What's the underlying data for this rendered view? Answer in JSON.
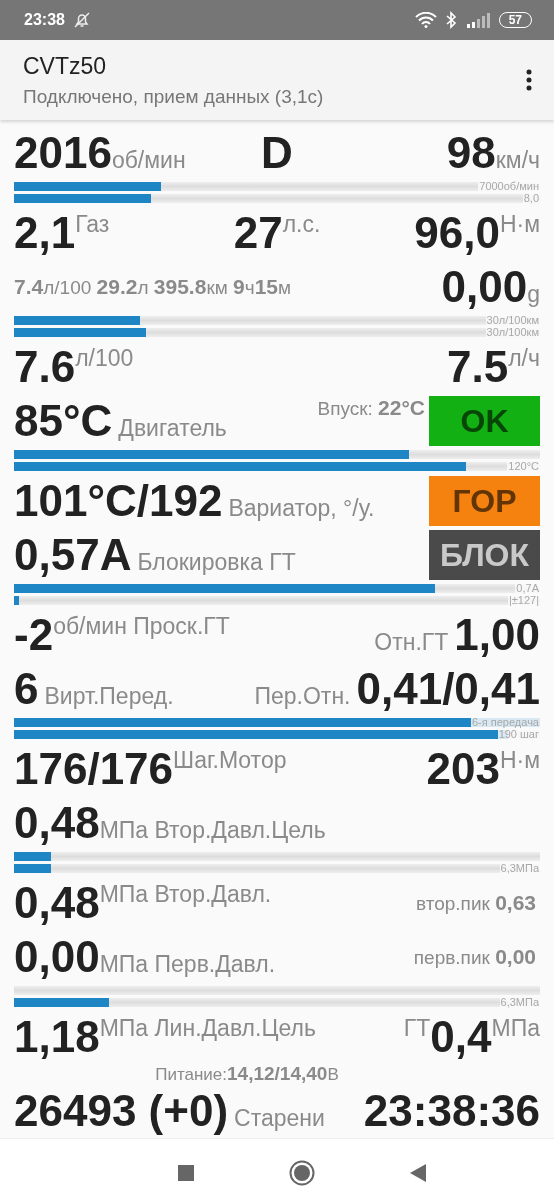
{
  "status_bar": {
    "time": "23:38",
    "battery": "57"
  },
  "app_bar": {
    "title": "CVTz50",
    "subtitle": "Подключено, прием данных (3,1с)"
  },
  "rows": [
    {
      "kind": "line",
      "left": [
        {
          "kind": "value",
          "text": "2016"
        },
        {
          "kind": "unit",
          "text": "об/мин"
        }
      ],
      "center": [
        {
          "kind": "value",
          "text": "D"
        }
      ],
      "right": [
        {
          "kind": "value",
          "text": "98"
        },
        {
          "kind": "unit",
          "text": "км/ч"
        }
      ]
    },
    {
      "kind": "bars",
      "bars": [
        {
          "level": 0.28,
          "caption": "7000об/мин"
        },
        {
          "level": 0.26,
          "caption": "8,0"
        }
      ]
    },
    {
      "kind": "line",
      "left": [
        {
          "kind": "value",
          "text": "2,1"
        },
        {
          "kind": "sup",
          "text": "Газ"
        }
      ],
      "center": [
        {
          "kind": "value",
          "text": "27"
        },
        {
          "kind": "sup",
          "text": "л.с."
        }
      ],
      "right": [
        {
          "kind": "value",
          "text": "96,0"
        },
        {
          "kind": "sup",
          "text": "Н·м"
        }
      ]
    },
    {
      "kind": "line",
      "left": [
        {
          "kind": "minor",
          "text": "**7.4**л/100 **29.2**л **395.8**км **9**ч**15**м"
        }
      ],
      "right": [
        {
          "kind": "value",
          "text": "0,00"
        },
        {
          "kind": "unit",
          "text": "g"
        }
      ]
    },
    {
      "kind": "bars",
      "bars": [
        {
          "level": 0.24,
          "caption": "30л/100км"
        },
        {
          "level": 0.25,
          "caption": "30л/100км"
        }
      ]
    },
    {
      "kind": "line",
      "left": [
        {
          "kind": "value",
          "text": "7.6"
        },
        {
          "kind": "sup",
          "text": "л/100"
        }
      ],
      "right": [
        {
          "kind": "value",
          "text": "7.5"
        },
        {
          "kind": "sup",
          "text": "л/ч"
        }
      ]
    },
    {
      "kind": "line",
      "left": [
        {
          "kind": "value",
          "text": "85°C"
        },
        {
          "kind": "label",
          "text": "Двигатель"
        }
      ],
      "right": [
        {
          "kind": "minor",
          "text": "Впуск: **22°C**"
        },
        {
          "kind": "badge",
          "color": "#12b012",
          "text": "OK"
        }
      ]
    },
    {
      "kind": "bars",
      "bars": [
        {
          "level": 0.75
        },
        {
          "level": 0.86,
          "caption": "120°C"
        }
      ]
    },
    {
      "kind": "line",
      "left": [
        {
          "kind": "value",
          "text": "101°C/192"
        },
        {
          "kind": "label",
          "text": "Вариатор, °/у."
        }
      ],
      "right": [
        {
          "kind": "badge",
          "color": "#f5820f",
          "text": "ГОР"
        }
      ]
    },
    {
      "kind": "line",
      "left": [
        {
          "kind": "value",
          "text": "0,57A"
        },
        {
          "kind": "label",
          "text": "Блокировка ГТ"
        }
      ],
      "right": [
        {
          "kind": "badge",
          "color": "#4a4a4a",
          "text": "БЛОК"
        }
      ]
    },
    {
      "kind": "bars",
      "bars": [
        {
          "level": 0.8,
          "caption": "0,7A"
        },
        {
          "level": 0.01,
          "caption": "|±127|"
        }
      ]
    },
    {
      "kind": "line",
      "left": [
        {
          "kind": "value",
          "text": "-2"
        },
        {
          "kind": "sup",
          "text": "об/мин Проск.ГТ"
        }
      ],
      "right": [
        {
          "kind": "label",
          "text": "Отн.ГТ"
        },
        {
          "kind": "value",
          "text": "1,00"
        }
      ]
    },
    {
      "kind": "line",
      "left": [
        {
          "kind": "value",
          "text": "6"
        },
        {
          "kind": "label",
          "text": "Вирт.Перед."
        }
      ],
      "right": [
        {
          "kind": "label",
          "text": "Пер.Отн."
        },
        {
          "kind": "value",
          "text": "0,41/0,41"
        }
      ]
    },
    {
      "kind": "bars",
      "bars": [
        {
          "level": 1.0,
          "caption": "6-я передача"
        },
        {
          "level": 0.94,
          "caption": "190 шаг"
        }
      ]
    },
    {
      "kind": "line",
      "left": [
        {
          "kind": "value",
          "text": "176/176"
        },
        {
          "kind": "sup",
          "text": "Шаг.Мотор"
        }
      ],
      "right": [
        {
          "kind": "value",
          "text": "203"
        },
        {
          "kind": "sup",
          "text": "Н·м"
        }
      ]
    },
    {
      "kind": "line",
      "left": [
        {
          "kind": "value",
          "text": "0,48"
        },
        {
          "kind": "unit",
          "text": "МПа Втор.Давл.Цель"
        }
      ]
    },
    {
      "kind": "bars",
      "bars": [
        {
          "level": 0.07
        },
        {
          "level": 0.07,
          "caption": "6,3МПа"
        }
      ]
    },
    {
      "kind": "line",
      "left": [
        {
          "kind": "value",
          "text": "0,48"
        },
        {
          "kind": "sup",
          "text": "МПа Втор.Давл."
        }
      ],
      "right": [
        {
          "kind": "minor",
          "text": "втор.пик **0,63**"
        }
      ]
    },
    {
      "kind": "line",
      "left": [
        {
          "kind": "value",
          "text": "0,00"
        },
        {
          "kind": "unit",
          "text": "МПа Перв.Давл."
        }
      ],
      "right": [
        {
          "kind": "minor",
          "text": "перв.пик **0,00**"
        }
      ]
    },
    {
      "kind": "bars",
      "bars": [
        {
          "level": 0
        },
        {
          "level": 0.18,
          "caption": "6,3МПа"
        }
      ]
    },
    {
      "kind": "line",
      "left": [
        {
          "kind": "value",
          "text": "1,18"
        },
        {
          "kind": "sup",
          "text": "МПа Лин.Давл.Цель"
        }
      ],
      "right": [
        {
          "kind": "sup",
          "text": "ГТ"
        },
        {
          "kind": "value",
          "text": "0,4"
        },
        {
          "kind": "sup",
          "text": "МПа"
        }
      ]
    },
    {
      "kind": "note",
      "text": "Питание:**14,12/14,40**В"
    },
    {
      "kind": "line",
      "left": [
        {
          "kind": "value",
          "text": "26493 (+0)"
        },
        {
          "kind": "label",
          "text": "Старени"
        }
      ],
      "right": [
        {
          "kind": "value",
          "text": "23:38:36"
        }
      ]
    }
  ]
}
